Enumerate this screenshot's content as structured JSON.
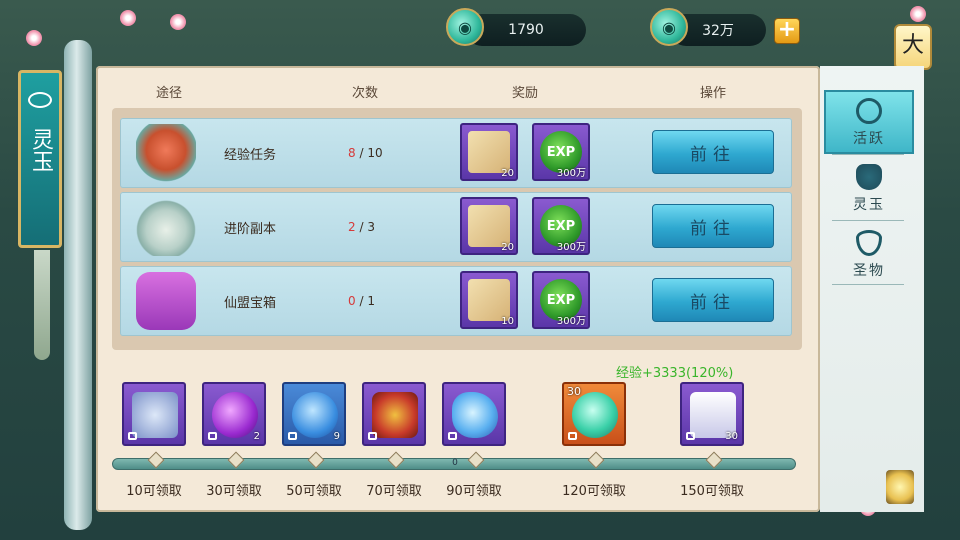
{
  "currency": {
    "jade": "1790",
    "gold": "32万",
    "add_label": "+"
  },
  "left_banner": {
    "title": "灵玉"
  },
  "corner_button": "大",
  "table": {
    "headers": {
      "path": "途径",
      "count": "次数",
      "reward": "奖励",
      "action": "操作"
    },
    "rows": [
      {
        "name": "经验任务",
        "done": "8",
        "total": "/ 10",
        "item_count": "20",
        "exp": "300万",
        "exp_label": "EXP",
        "button": "前往"
      },
      {
        "name": "进阶副本",
        "done": "2",
        "total": "/ 3",
        "item_count": "20",
        "exp": "300万",
        "exp_label": "EXP",
        "button": "前往"
      },
      {
        "name": "仙盟宝箱",
        "done": "0",
        "total": "/ 1",
        "item_count": "10",
        "exp": "300万",
        "exp_label": "EXP",
        "button": "前往"
      }
    ]
  },
  "bonus_text": "经验+3333(120%)",
  "progress": {
    "value": 0,
    "label": "0"
  },
  "rewards": [
    {
      "label": "10可领取",
      "count": "",
      "top": ""
    },
    {
      "label": "30可领取",
      "count": "2",
      "top": ""
    },
    {
      "label": "50可领取",
      "count": "9",
      "top": ""
    },
    {
      "label": "70可领取",
      "count": "",
      "top": ""
    },
    {
      "label": "90可领取",
      "count": "",
      "top": ""
    },
    {
      "label": "120可领取",
      "count": "",
      "top": "30"
    },
    {
      "label": "150可领取",
      "count": "30",
      "top": ""
    }
  ],
  "tabs": [
    {
      "label": "活跃",
      "icon": "wheel-icon",
      "active": true
    },
    {
      "label": "灵玉",
      "icon": "demon-mask-icon",
      "active": false
    },
    {
      "label": "圣物",
      "icon": "eye-icon",
      "active": false
    }
  ],
  "colors": {
    "accent_done": "#d63a3a",
    "bonus": "#39b52a",
    "button": "#2ea8d0"
  }
}
